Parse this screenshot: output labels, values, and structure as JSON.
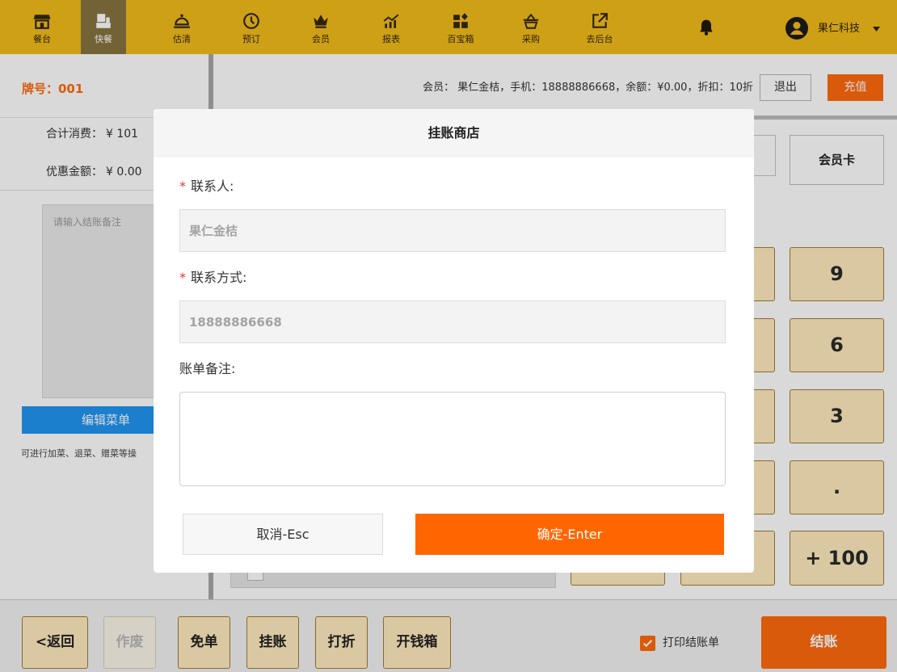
{
  "colors": {
    "nav": "#f3bd1b",
    "nav_active": "#877440",
    "accent": "#ff6a0d",
    "primary_blue": "#2196f3",
    "key_bg": "#ffecbe",
    "key_border": "#a07d3a",
    "required": "#e53935",
    "confirm": "#ff6600"
  },
  "nav": {
    "items": [
      {
        "label": "餐台",
        "icon": "store-icon",
        "active": false
      },
      {
        "label": "快餐",
        "icon": "fast-food-icon",
        "active": true
      },
      {
        "label": "估清",
        "icon": "cloche-icon",
        "active": false
      },
      {
        "label": "预订",
        "icon": "clock-icon",
        "active": false
      },
      {
        "label": "会员",
        "icon": "crown-icon",
        "active": false
      },
      {
        "label": "报表",
        "icon": "chart-icon",
        "active": false
      },
      {
        "label": "百宝箱",
        "icon": "treasure-box-icon",
        "active": false
      },
      {
        "label": "采购",
        "icon": "basket-icon",
        "active": false
      },
      {
        "label": "去后台",
        "icon": "external-link-icon",
        "active": false
      }
    ],
    "notification_icon": "bell-icon",
    "user": {
      "avatar_icon": "user-avatar-icon",
      "name": "果仁科技",
      "menu_icon": "caret-down-icon"
    }
  },
  "order": {
    "table_no": "牌号：001",
    "total_label": "合计消费：",
    "total_value": "¥ 101",
    "discount_label": "优惠金额：",
    "discount_value": "¥ 0.00",
    "remark_placeholder": "请输入结账备注",
    "edit_menu_label": "编辑菜单",
    "hint": "可进行加菜、退菜、赠菜等操"
  },
  "member": {
    "info": "会员： 果仁金桔，手机：18888886668，余额：¥0.00，折扣：10折",
    "logout_label": "退出",
    "recharge_label": "充值"
  },
  "payment": {
    "member_card_label": "会员卡"
  },
  "keypad": {
    "keys": [
      "9",
      "6",
      "3",
      ".",
      "+ 100"
    ]
  },
  "footer": {
    "back_label": "<返回",
    "void_label": "作废",
    "void_disabled": true,
    "free_label": "免单",
    "credit_label": "挂账",
    "discount_label": "打折",
    "cash_drawer_label": "开钱箱",
    "print_receipt": {
      "label": "打印结账单",
      "checked": true,
      "icon": "checkmark-icon"
    },
    "checkout_label": "结账"
  },
  "modal": {
    "title": "挂账商店",
    "required_mark": "*",
    "contact_label": "联系人:",
    "contact_value": "果仁金桔",
    "phone_label": "联系方式:",
    "phone_value": "18888886668",
    "remark_label": "账单备注:",
    "cancel_label": "取消-Esc",
    "confirm_label": "确定-Enter"
  }
}
